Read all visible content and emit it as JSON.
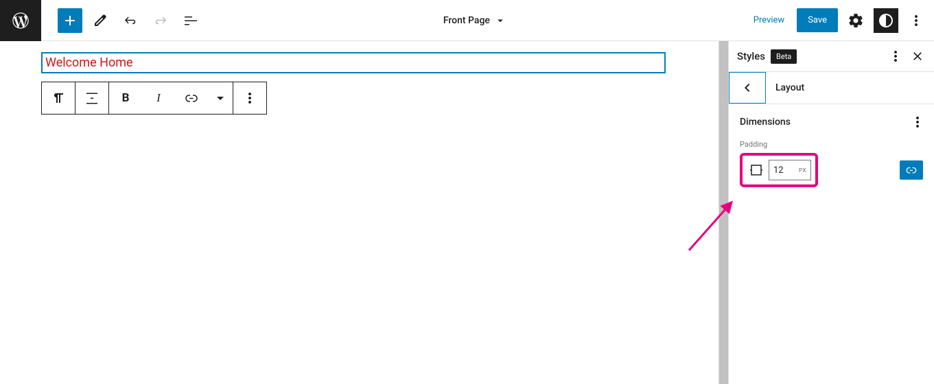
{
  "document": {
    "title": "Front Page"
  },
  "header": {
    "preview": "Preview",
    "save": "Save"
  },
  "canvas": {
    "block_text": "Welcome Home"
  },
  "sidebar": {
    "title": "Styles",
    "badge": "Beta",
    "layout_label": "Layout",
    "dimensions_label": "Dimensions",
    "padding": {
      "label": "Padding",
      "value": "12",
      "unit": "PX"
    }
  },
  "colors": {
    "primary": "#007cba",
    "annotation": "#e6007e",
    "input_text": "#cc1818"
  }
}
